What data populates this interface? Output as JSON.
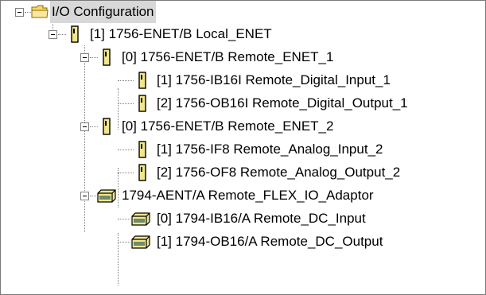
{
  "tree": {
    "root": {
      "label": "I/O Configuration",
      "icon": "folder-icon"
    },
    "items": [
      {
        "label": "[1] 1756-ENET/B Local_ENET",
        "icon": "module-icon"
      },
      {
        "label": "[0] 1756-ENET/B Remote_ENET_1",
        "icon": "module-icon"
      },
      {
        "label": "[1] 1756-IB16I Remote_Digital_Input_1",
        "icon": "module-icon"
      },
      {
        "label": "[2] 1756-OB16I Remote_Digital_Output_1",
        "icon": "module-icon"
      },
      {
        "label": "[0] 1756-ENET/B Remote_ENET_2",
        "icon": "module-icon"
      },
      {
        "label": "[1] 1756-IF8 Remote_Analog_Input_2",
        "icon": "module-icon"
      },
      {
        "label": "[2] 1756-OF8 Remote_Analog_Output_2",
        "icon": "module-icon"
      },
      {
        "label": "1794-AENT/A Remote_FLEX_IO_Adaptor",
        "icon": "flex-adapter-icon"
      },
      {
        "label": "[0] 1794-IB16/A Remote_DC_Input",
        "icon": "flex-module-icon"
      },
      {
        "label": "[1] 1794-OB16/A Remote_DC_Output",
        "icon": "flex-module-icon"
      }
    ]
  },
  "colors": {
    "selection": "#d8d8d8",
    "folder": "#f5d76e",
    "module": "#f0e68c"
  }
}
